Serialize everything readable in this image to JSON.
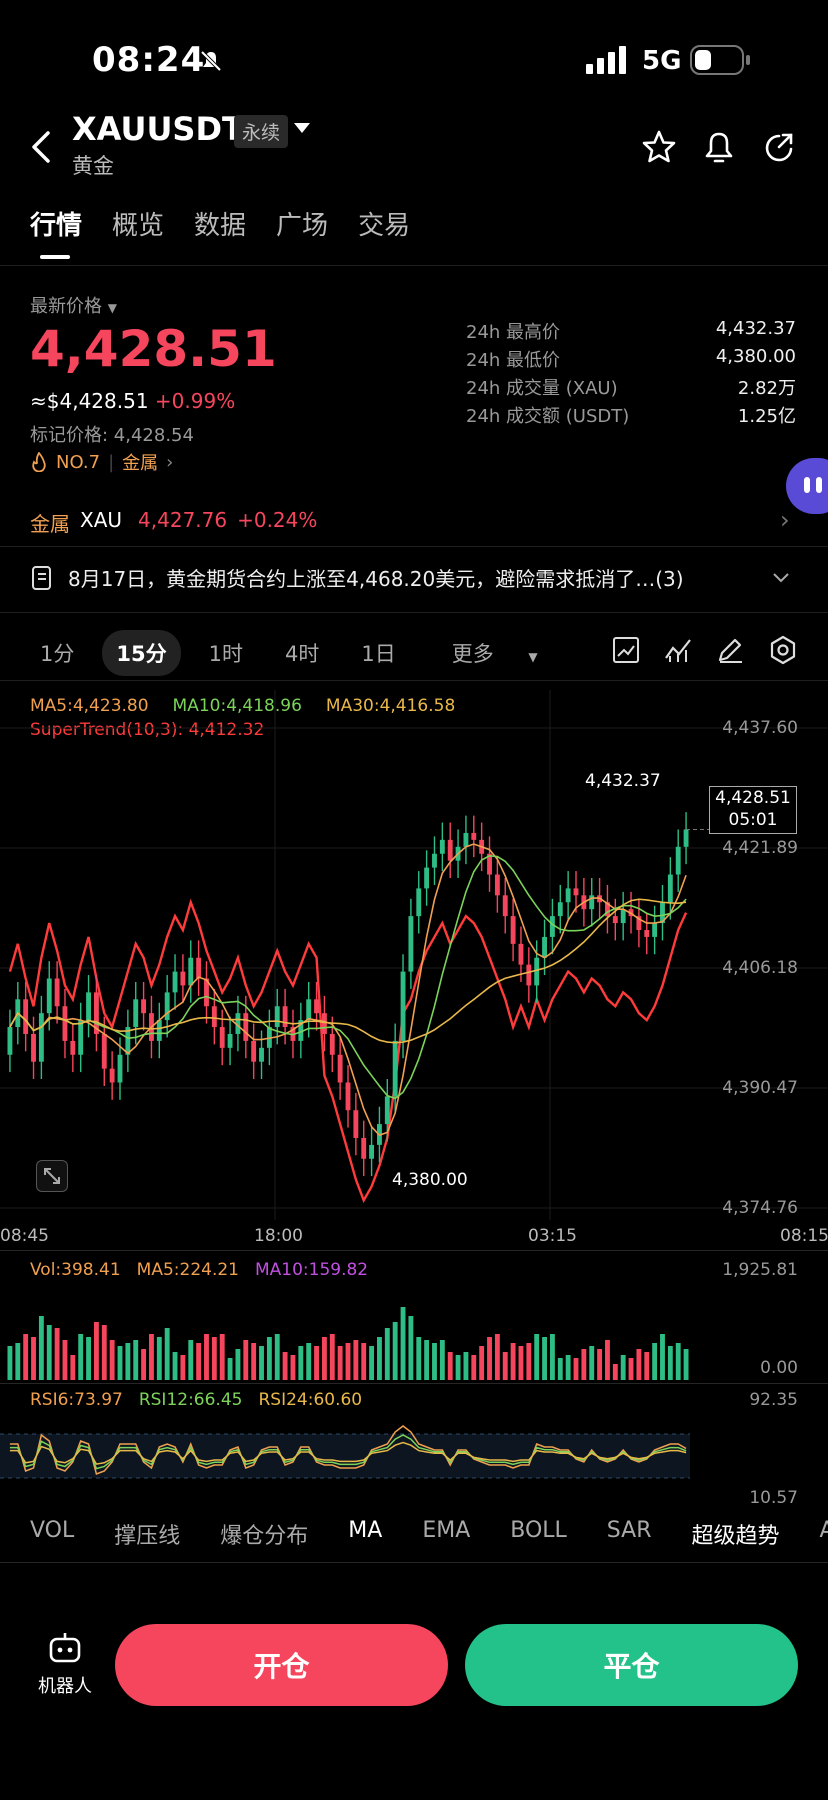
{
  "status": {
    "time": "08:24",
    "network": "5G"
  },
  "header": {
    "symbol": "XAUUSDT",
    "contract_tag": "永续",
    "subtitle": "黄金"
  },
  "tabs": [
    "行情",
    "概览",
    "数据",
    "广场",
    "交易"
  ],
  "price": {
    "label": "最新价格",
    "last": "4,428.51",
    "usd": "≈$4,428.51",
    "change": "+0.99%",
    "mark": "标记价格: 4,428.54",
    "rank": "NO.7",
    "category": "金属"
  },
  "stats": [
    {
      "k": "24h 最高价",
      "v": "4,432.37"
    },
    {
      "k": "24h 最低价",
      "v": "4,380.00"
    },
    {
      "k": "24h 成交量 (XAU)",
      "v": "2.82万"
    },
    {
      "k": "24h 成交额 (USDT)",
      "v": "1.25亿"
    }
  ],
  "index": {
    "label": "金属",
    "symbol": "XAU",
    "price": "4,427.76",
    "change": "+0.24%"
  },
  "news": {
    "text": "8月17日，黄金期货合约上涨至4,468.20美元，避险需求抵消了…",
    "count": "(3)"
  },
  "timeframes": [
    "1分",
    "15分",
    "1时",
    "4时",
    "1日",
    "更多"
  ],
  "indicators": {
    "ma5": "MA5:4,423.80",
    "ma10": "MA10:4,418.96",
    "ma30": "MA30:4,416.58",
    "supertrend": "SuperTrend(10,3): 4,412.32",
    "vol": "Vol:398.41",
    "vol_ma5": "MA5:224.21",
    "vol_ma10": "MA10:159.82",
    "rsi6": "RSI6:73.97",
    "rsi12": "RSI12:66.45",
    "rsi24": "RSI24:60.60"
  },
  "chart_data": {
    "type": "candlestick",
    "y_ticks": [
      "4,437.60",
      "4,421.89",
      "4,406.18",
      "4,390.47",
      "4,374.76"
    ],
    "x_ticks": [
      "08:45",
      "18:00",
      "03:15",
      "08:15"
    ],
    "high_label": "4,432.37",
    "low_label": "4,380.00",
    "current_price": "4,428.51",
    "countdown": "05:01",
    "vol_ticks": [
      "1,925.81",
      "0.00"
    ],
    "rsi_ticks": [
      "92.35",
      "10.57"
    ],
    "closes": [
      4400,
      4404,
      4399,
      4395,
      4402,
      4407,
      4403,
      4398,
      4396,
      4401,
      4405,
      4399,
      4394,
      4392,
      4396,
      4400,
      4404,
      4402,
      4398,
      4401,
      4405,
      4408,
      4406,
      4410,
      4407,
      4403,
      4400,
      4397,
      4399,
      4402,
      4398,
      4395,
      4397,
      4400,
      4403,
      4400,
      4398,
      4401,
      4404,
      4402,
      4399,
      4396,
      4392,
      4388,
      4384,
      4381,
      4383,
      4386,
      4390,
      4398,
      4408,
      4416,
      4420,
      4423,
      4425,
      4427,
      4424,
      4426,
      4428,
      4427,
      4425,
      4422,
      4419,
      4416,
      4412,
      4409,
      4406,
      4410,
      4413,
      4416,
      4418,
      4420,
      4419,
      4417,
      4419,
      4418,
      4416,
      4415,
      4417,
      4416,
      4414,
      4413,
      4415,
      4418,
      4422,
      4426,
      4428.5
    ],
    "opens": [
      4396,
      4400,
      4404,
      4399,
      4395,
      4402,
      4407,
      4403,
      4398,
      4396,
      4401,
      4405,
      4399,
      4394,
      4392,
      4396,
      4400,
      4404,
      4402,
      4398,
      4401,
      4405,
      4408,
      4406,
      4410,
      4407,
      4403,
      4400,
      4397,
      4399,
      4402,
      4398,
      4395,
      4397,
      4400,
      4403,
      4400,
      4398,
      4401,
      4404,
      4402,
      4399,
      4396,
      4392,
      4388,
      4384,
      4381,
      4383,
      4386,
      4390,
      4398,
      4408,
      4416,
      4420,
      4423,
      4425,
      4427,
      4424,
      4426,
      4428,
      4427,
      4425,
      4422,
      4419,
      4416,
      4412,
      4409,
      4406,
      4410,
      4413,
      4416,
      4418,
      4420,
      4419,
      4417,
      4419,
      4418,
      4416,
      4415,
      4417,
      4416,
      4414,
      4413,
      4415,
      4418,
      4422,
      4426
    ],
    "ylim": [
      4374.76,
      4437.6
    ]
  },
  "indicator_tabs": [
    "VOL",
    "撑压线",
    "爆仓分布",
    "MA",
    "EMA",
    "BOLL",
    "SAR",
    "超级趋势",
    "AVL"
  ],
  "actions": {
    "robot": "机器人",
    "open": "开仓",
    "close": "平仓"
  },
  "colors": {
    "up": "#2ebd85",
    "down": "#f6465d",
    "ma5": "#f0a050",
    "ma10": "#7cd35a",
    "ma30": "#e8b84a",
    "supertrend": "#ff3b3b"
  }
}
